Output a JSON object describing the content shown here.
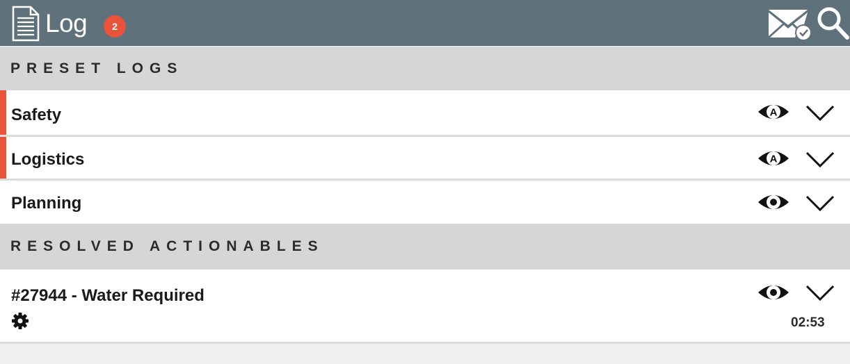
{
  "header": {
    "title": "Log",
    "badge_count": "2",
    "icons": [
      "document-icon",
      "mail-check-icon",
      "search-icon"
    ],
    "bar_color": "#5f727c",
    "badge_color": "#e8533c"
  },
  "sections": {
    "preset": {
      "title": "PRESET LOGS"
    },
    "resolved": {
      "title": "RESOLVED ACTIONABLES"
    }
  },
  "preset_logs": [
    {
      "label": "Safety",
      "flagged": true,
      "icon": "eye-a-icon"
    },
    {
      "label": "Logistics",
      "flagged": true,
      "icon": "eye-a-icon"
    },
    {
      "label": "Planning",
      "flagged": false,
      "icon": "eye-icon"
    }
  ],
  "resolved_actionables": [
    {
      "label": "#27944 - Water Required",
      "time": "02:53",
      "icon": "gear-icon"
    }
  ],
  "colors": {
    "accent_flag": "#e8533c",
    "section_bg": "#d6d6d6"
  }
}
